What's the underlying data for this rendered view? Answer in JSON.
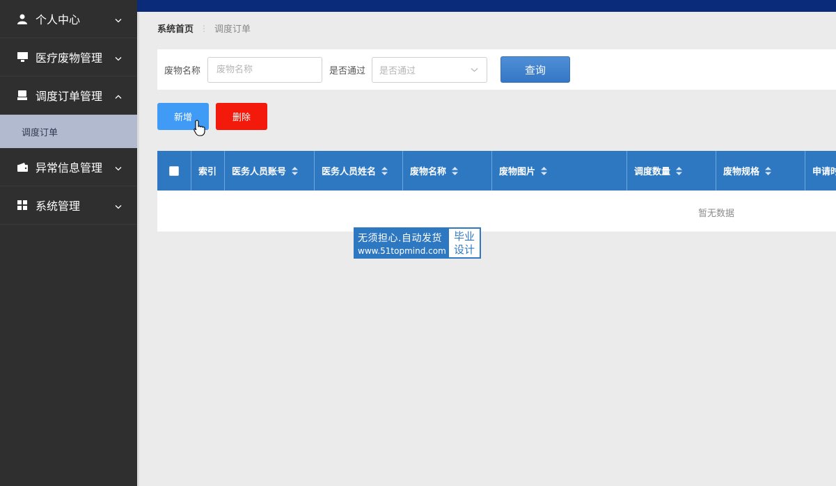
{
  "sidebar": {
    "items": [
      {
        "label": "个人中心",
        "icon": "user-icon",
        "expanded": false
      },
      {
        "label": "医疗废物管理",
        "icon": "monitor-icon",
        "expanded": false
      },
      {
        "label": "调度订单管理",
        "icon": "printer-icon",
        "expanded": true
      },
      {
        "label": "异常信息管理",
        "icon": "wallet-icon",
        "expanded": false
      },
      {
        "label": "系统管理",
        "icon": "grid-icon",
        "expanded": false
      }
    ],
    "submenu": {
      "label": "调度订单"
    }
  },
  "breadcrumb": {
    "home": "系统首页",
    "separator": "⋮",
    "current": "调度订单"
  },
  "search": {
    "name_label": "废物名称",
    "name_placeholder": "废物名称",
    "pass_label": "是否通过",
    "pass_placeholder": "是否通过",
    "query_label": "查询"
  },
  "actions": {
    "add_label": "新增",
    "delete_label": "删除"
  },
  "table": {
    "columns": [
      {
        "label": "索引",
        "sortable": false
      },
      {
        "label": "医务人员账号",
        "sortable": true
      },
      {
        "label": "医务人员姓名",
        "sortable": true
      },
      {
        "label": "废物名称",
        "sortable": true
      },
      {
        "label": "废物图片",
        "sortable": true
      },
      {
        "label": "调度数量",
        "sortable": true
      },
      {
        "label": "废物规格",
        "sortable": true
      },
      {
        "label": "申请时",
        "sortable": false
      }
    ],
    "empty_text": "暂无数据"
  },
  "watermark": {
    "line1": "无须担心.自动发货",
    "line2": "www.51topmind.com",
    "right1": "毕业",
    "right2": "设计"
  },
  "colors": {
    "sidebar_bg": "#2f2f2f",
    "submenu_active_bg": "#b2bad0",
    "table_header": "#2e78c2",
    "add_button": "#3f9bf5",
    "delete_button": "#f41a0b",
    "topbar": "#0a2a7a"
  }
}
